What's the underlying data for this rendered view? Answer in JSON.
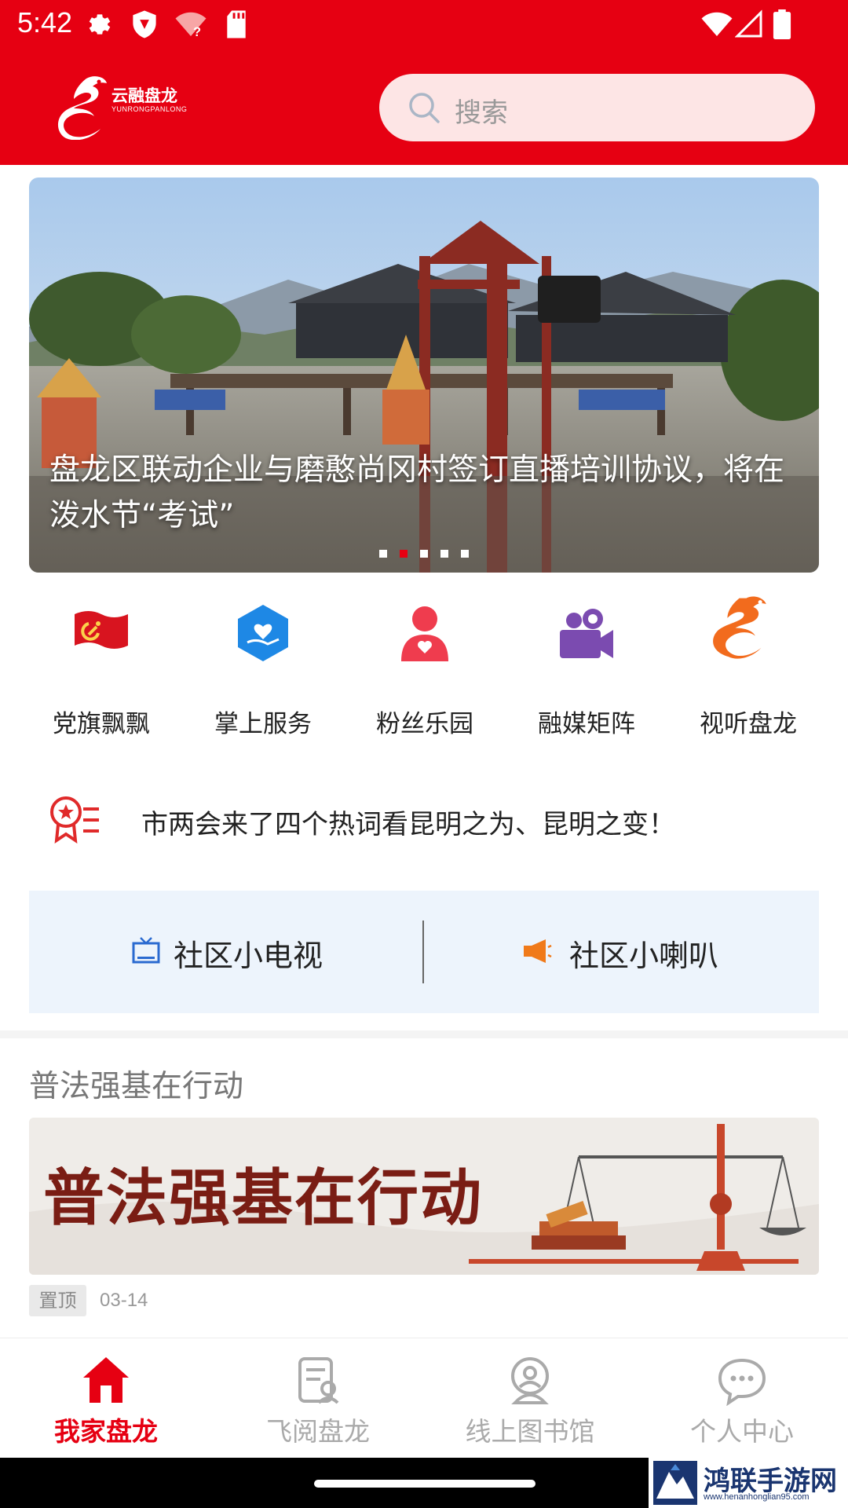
{
  "status_bar": {
    "time": "5:42",
    "left_icons": [
      "gear-icon",
      "shield-icon",
      "wifi-question-icon",
      "sd-card-icon"
    ],
    "right_icons": [
      "wifi-icon",
      "signal-icon",
      "battery-icon"
    ]
  },
  "header": {
    "logo_text": "云融盘龙",
    "logo_subtext": "YUNRONGPANLONG",
    "search_placeholder": "搜索"
  },
  "banner": {
    "title": "盘龙区联动企业与磨憨尚冈村签订直播培训协议，将在泼水节“考试”",
    "slide_count": 5,
    "active_slide": 2
  },
  "quick_nav": [
    {
      "label": "党旗飘飘",
      "icon": "party-flag-icon"
    },
    {
      "label": "掌上服务",
      "icon": "hand-service-icon"
    },
    {
      "label": "粉丝乐园",
      "icon": "fan-user-icon"
    },
    {
      "label": "融媒矩阵",
      "icon": "video-camera-icon"
    },
    {
      "label": "视听盘龙",
      "icon": "dragon-logo-icon"
    }
  ],
  "headline": {
    "icon": "award-list-icon",
    "text": "市两会来了四个热词看昆明之为、昆明之变！"
  },
  "community": {
    "tv_label": "社区小电视",
    "speaker_label": "社区小喇叭"
  },
  "article_section": {
    "title": "普法强基在行动",
    "image_text": "普法强基在行动",
    "pin_label": "置顶",
    "date": "03-14"
  },
  "bottom_nav": [
    {
      "label": "我家盘龙",
      "icon": "home-icon",
      "active": true
    },
    {
      "label": "飞阅盘龙",
      "icon": "document-icon",
      "active": false
    },
    {
      "label": "线上图书馆",
      "icon": "library-icon",
      "active": false
    },
    {
      "label": "个人中心",
      "icon": "chat-bubble-icon",
      "active": false
    }
  ],
  "watermark": {
    "title": "鸿联手游网",
    "url": "www.henanhonglian95.com"
  },
  "colors": {
    "brand_red": "#e60012",
    "search_bg": "#fde5e5",
    "community_bg": "#edf4fc",
    "tv_blue": "#2a6ad0",
    "speaker_orange": "#f07a1a"
  }
}
